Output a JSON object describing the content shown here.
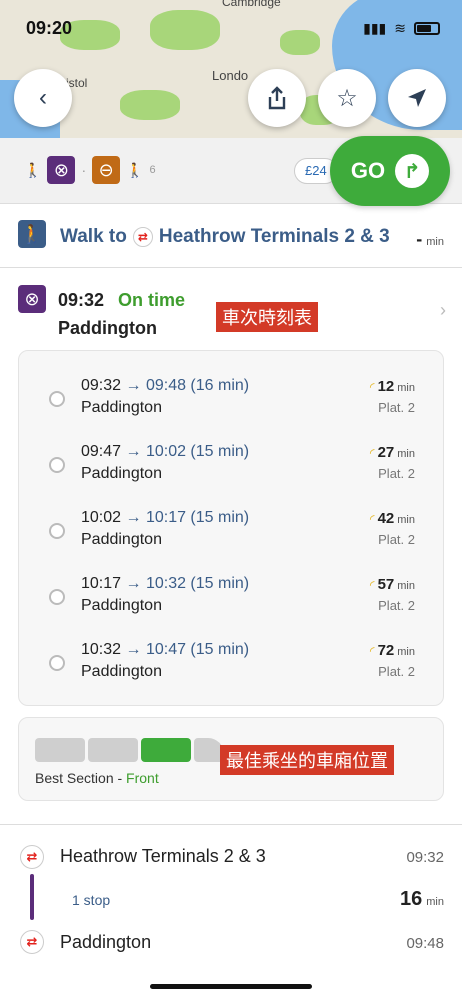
{
  "status_bar": {
    "time": "09:20"
  },
  "map": {
    "labels": {
      "cambridge": "Cambridge",
      "london": "Londo",
      "bristol": "istol"
    }
  },
  "map_buttons": {
    "back": "back-icon",
    "share": "share-icon",
    "favorite": "star-icon",
    "locate": "location-arrow-icon"
  },
  "route_strip": {
    "walk_end_minutes": "6",
    "price": "£24",
    "go_label": "GO"
  },
  "walk_step": {
    "prefix": "Walk to",
    "destination": "Heathrow Terminals 2 & 3",
    "minutes": "-",
    "min_unit": "min"
  },
  "departure": {
    "time": "09:32",
    "status": "On time",
    "station": "Paddington",
    "annotation": "車次時刻表"
  },
  "schedule": [
    {
      "dep": "09:32",
      "arr": "→ 09:48 (16 min)",
      "station": "Paddington",
      "live": "12",
      "unit": "min",
      "platform": "Plat. 2"
    },
    {
      "dep": "09:47",
      "arr": "→ 10:02 (15 min)",
      "station": "Paddington",
      "live": "27",
      "unit": "min",
      "platform": "Plat. 2"
    },
    {
      "dep": "10:02",
      "arr": "→ 10:17 (15 min)",
      "station": "Paddington",
      "live": "42",
      "unit": "min",
      "platform": "Plat. 2"
    },
    {
      "dep": "10:17",
      "arr": "→ 10:32 (15 min)",
      "station": "Paddington",
      "live": "57",
      "unit": "min",
      "platform": "Plat. 2"
    },
    {
      "dep": "10:32",
      "arr": "→ 10:47 (15 min)",
      "station": "Paddington",
      "live": "72",
      "unit": "min",
      "platform": "Plat. 2"
    }
  ],
  "best_section": {
    "label": "Best Section - ",
    "value": "Front",
    "annotation": "最佳乘坐的車廂位置"
  },
  "trip": {
    "from": "Heathrow Terminals 2 & 3",
    "from_time": "09:32",
    "stops": "1 stop",
    "duration": "16",
    "duration_unit": "min",
    "to": "Paddington",
    "to_time": "09:48"
  },
  "colors": {
    "go_green": "#3eab3b",
    "on_time_green": "#3e9d2e",
    "link_blue": "#3b5d88",
    "line_purple": "#5b2d7a",
    "annotation_red": "#d33a27"
  }
}
